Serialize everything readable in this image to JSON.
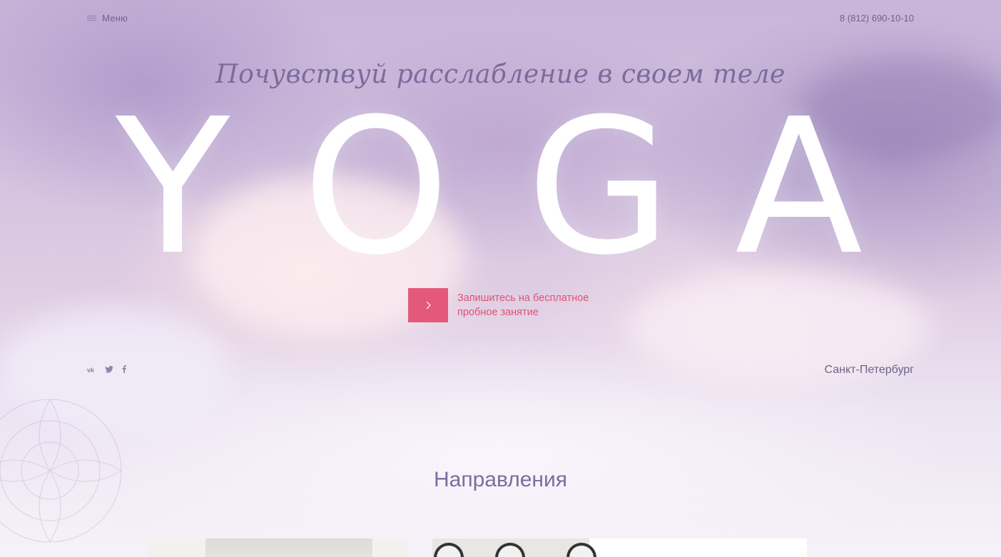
{
  "header": {
    "menu_icon": "menu-lines-icon",
    "menu_label": "Меню",
    "phone": "8 (812) 690-10-10"
  },
  "hero": {
    "tagline": "Почувствуй расслабление в своем теле",
    "title_letters": [
      "Y",
      "O",
      "G",
      "A"
    ],
    "cta": {
      "button_icon": "chevron-right-icon",
      "text_line1": "Запишитесь на бесплатное",
      "text_line2": "пробное занятие"
    },
    "social": [
      {
        "name": "vk",
        "label": "vk"
      },
      {
        "name": "twitter",
        "label": "twitter-icon"
      },
      {
        "name": "facebook",
        "label": "f"
      }
    ],
    "city": "Санкт-Петербург"
  },
  "sections": {
    "directions_title": "Направления"
  },
  "colors": {
    "accent": "#e4587a",
    "accent_text": "#e05173",
    "heading": "#7b6e9c",
    "nav_text": "#6e6488"
  }
}
